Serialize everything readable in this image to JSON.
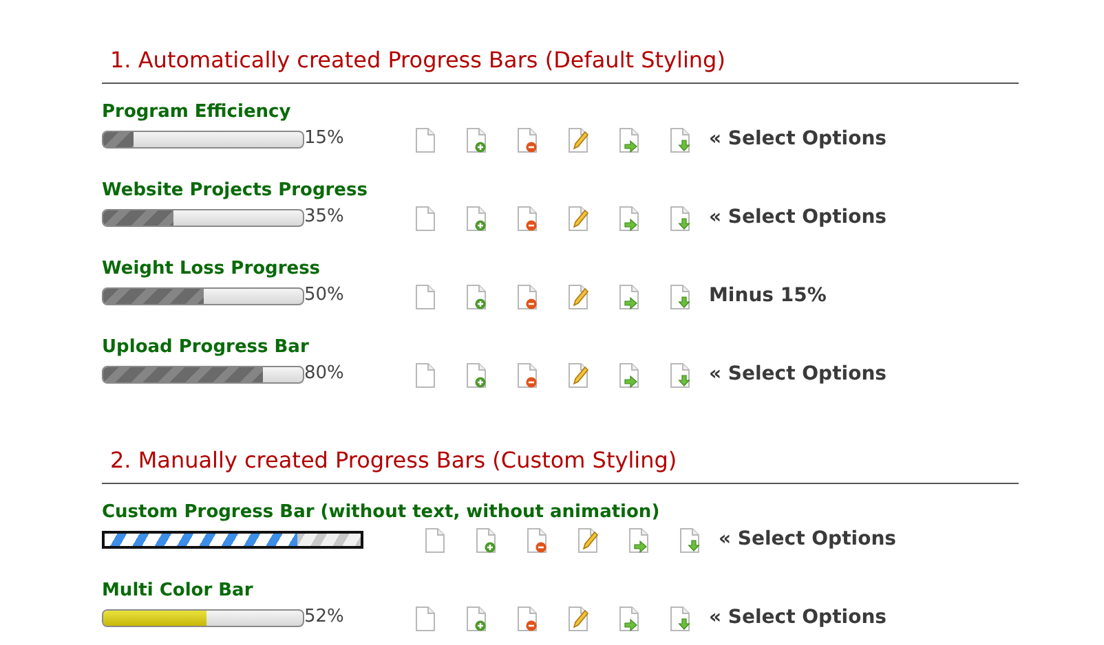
{
  "sections": [
    {
      "title": "1. Automatically created Progress Bars (Default Styling)",
      "bars": [
        {
          "kind": "default",
          "label": "Program Efficiency",
          "level": 0.15,
          "reading": "15%",
          "option": "« Select Options"
        },
        {
          "kind": "default",
          "label": "Website Projects Progress",
          "level": 0.35,
          "reading": "35%",
          "option": "« Select Options"
        },
        {
          "kind": "default",
          "label": "Weight Loss Progress",
          "level": 0.5,
          "reading": "50%",
          "option": "Minus 15%"
        },
        {
          "kind": "default",
          "label": "Upload Progress Bar",
          "level": 0.8,
          "reading": "80%",
          "option": "« Select Options"
        }
      ]
    },
    {
      "title": "2. Manually created Progress Bars (Custom Styling)",
      "bars": [
        {
          "kind": "custom",
          "label": "Custom Progress Bar (without text, without animation)",
          "level": 0.75,
          "option": "« Select Options"
        },
        {
          "kind": "multicolor",
          "label": "Multi Color Bar",
          "level": 0.52,
          "reading": "52%",
          "option": "« Select Options"
        }
      ]
    }
  ]
}
